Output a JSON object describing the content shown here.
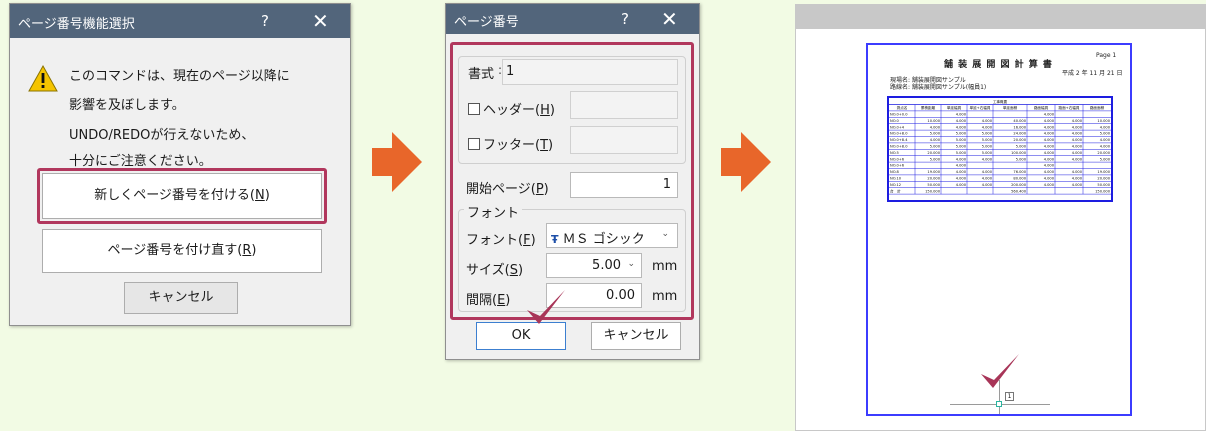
{
  "dialog1": {
    "title": "ページ番号機能選択",
    "help": "?",
    "close": "✕",
    "message_line1": "このコマンドは、現在のページ以降に",
    "message_line2": "影響を及ぼします。",
    "message_line3": "UNDO/REDOが行えないため、",
    "message_line4": "十分にご注意ください。",
    "btn_new_prefix": "新しくページ番号を付ける(",
    "btn_new_key": "N",
    "btn_renumber_prefix": "ページ番号を付け直す(",
    "btn_renumber_key": "R",
    "btn_suffix": ")",
    "btn_cancel": "キャンセル"
  },
  "dialog2": {
    "title": "ページ番号",
    "help": "?",
    "close": "✕",
    "format_label": "書式",
    "format_value": "1",
    "header_prefix": "ヘッダー(",
    "header_key": "H",
    "footer_prefix": "フッター(",
    "footer_key": "T",
    "suffix": ")",
    "start_page_prefix": "開始ページ(",
    "start_page_key": "P",
    "start_page_value": "1",
    "font_group": "フォント",
    "font_prefix": "フォント(",
    "font_key": "F",
    "font_value": "ＭＳ ゴシック",
    "font_icon_text": "Ŧ",
    "size_prefix": "サイズ(",
    "size_key": "S",
    "size_value": "5.00",
    "size_unit": "mm",
    "spacing_prefix": "間隔(",
    "spacing_key": "E",
    "spacing_value": "0.00",
    "spacing_unit": "mm",
    "ok": "OK",
    "cancel": "キャンセル"
  },
  "preview": {
    "page_label": "Page 1",
    "doc_title": "舗 装 展 開 図 計 算 書",
    "date": "平成 2 年 11 月 21 日",
    "site_line1": "現場名: 舗装展開図サンプル",
    "site_line2": "路線名: 舗装展開図サンプル(幅員1)",
    "table_group": "工事概要",
    "table_headers": [
      "測点名",
      "累積距離",
      "単延幅員",
      "単延+右幅員",
      "単延面積",
      "路面幅員",
      "路面+右幅員",
      "路面面積"
    ],
    "table_rows": [
      [
        "NO.0+0.0",
        "",
        "4.000",
        "",
        "",
        "4.000",
        "",
        ""
      ],
      [
        "NO.0",
        "10.000",
        "4.000",
        "4.000",
        "40.000",
        "4.000",
        "4.000",
        "10.000"
      ],
      [
        "NO.0+4",
        "4.000",
        "4.000",
        "4.000",
        "16.000",
        "4.000",
        "4.000",
        "4.000"
      ],
      [
        "NO.0+8.0",
        "5.000",
        "5.000",
        "5.000",
        "24.000",
        "4.000",
        "4.000",
        "5.000"
      ],
      [
        "NO.0+8.4",
        "4.000",
        "5.000",
        "5.000",
        "20.000",
        "4.000",
        "4.000",
        "4.000"
      ],
      [
        "NO.0+8.0",
        "5.000",
        "5.000",
        "5.000",
        "5.000",
        "4.000",
        "4.000",
        "4.000"
      ],
      [
        "NO.5",
        "20.000",
        "5.000",
        "5.000",
        "100.000",
        "4.000",
        "4.000",
        "20.000"
      ],
      [
        "NO.0+6",
        "5.000",
        "4.000",
        "4.000",
        "5.000",
        "4.000",
        "4.000",
        "5.000"
      ],
      [
        "NO.0+6",
        "",
        "4.000",
        "",
        "",
        "4.000",
        "",
        ""
      ],
      [
        "NO.8",
        "19.000",
        "4.000",
        "4.000",
        "76.000",
        "4.000",
        "4.000",
        "19.000"
      ],
      [
        "NO.10",
        "20.000",
        "4.000",
        "4.000",
        "80.000",
        "4.000",
        "4.000",
        "20.000"
      ],
      [
        "NO.12",
        "50.000",
        "4.000",
        "4.000",
        "200.000",
        "4.000",
        "4.000",
        "50.000"
      ],
      [
        "合　計",
        "150.000",
        "",
        "",
        "560.400",
        "",
        "",
        "150.000"
      ]
    ],
    "footer_page_number": "1"
  },
  "colors": {
    "background": "#f2fbe4",
    "titlebar": "#52657b",
    "highlight": "#b1375d",
    "arrow": "#e8662a",
    "check": "#a83558",
    "page_border": "#3c3cff"
  }
}
